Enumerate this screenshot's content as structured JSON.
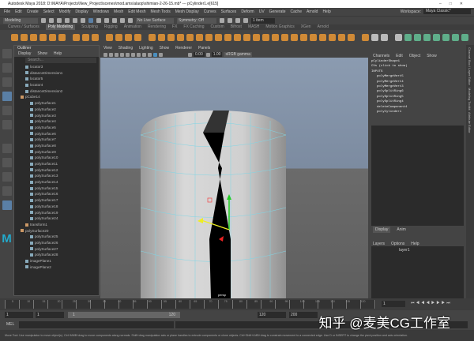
{
  "title": "Autodesk Maya 2018: D:\\MAYA\\Projects\\New_Project\\scenes\\mod.ams\\alaop\\shimian-2-26-15.mb* --- pCylinder1.e[615]",
  "menu": [
    "File",
    "Edit",
    "Create",
    "Select",
    "Modify",
    "Display",
    "Windows",
    "Mesh",
    "Edit Mesh",
    "Mesh Tools",
    "Mesh Display",
    "Curves",
    "Surfaces",
    "Deform",
    "UV",
    "Generate",
    "Cache",
    "Arnold",
    "Help"
  ],
  "workspace": {
    "label": "Workspace:",
    "value": "Maya Classic*"
  },
  "status": {
    "mode": "Modeling",
    "live": "No Live Surface",
    "symmetry": "Symmetry: Off",
    "field": "1 item"
  },
  "shelf_tabs": [
    "Curves / Surfaces",
    "Poly Modeling",
    "Sculpting",
    "Rigging",
    "Animation",
    "Rendering",
    "FX",
    "FX Caching",
    "Custom",
    "Bifrost",
    "MASH",
    "Motion Graphics",
    "XGen",
    "Arnold"
  ],
  "shelf_active": 1,
  "outliner": {
    "title": "Outliner",
    "menu": [
      "Display",
      "Show",
      "Help"
    ],
    "search": "Search...",
    "items": [
      {
        "n": "locator3",
        "d": 1
      },
      {
        "n": "distanceDimension1",
        "d": 1
      },
      {
        "n": "locator5",
        "d": 1
      },
      {
        "n": "locator4",
        "d": 1
      },
      {
        "n": "distanceDimension2",
        "d": 1
      },
      {
        "n": "pCube14",
        "d": 0,
        "t": 1
      },
      {
        "n": "polySurface1",
        "d": 2
      },
      {
        "n": "polySurface2",
        "d": 2
      },
      {
        "n": "polySurface3",
        "d": 2
      },
      {
        "n": "polySurface4",
        "d": 2
      },
      {
        "n": "polySurface5",
        "d": 2
      },
      {
        "n": "polySurface6",
        "d": 2
      },
      {
        "n": "polySurface7",
        "d": 2
      },
      {
        "n": "polySurface8",
        "d": 2
      },
      {
        "n": "polySurface9",
        "d": 2
      },
      {
        "n": "polySurface10",
        "d": 2
      },
      {
        "n": "polySurface11",
        "d": 2
      },
      {
        "n": "polySurface12",
        "d": 2
      },
      {
        "n": "polySurface13",
        "d": 2
      },
      {
        "n": "polySurface14",
        "d": 2
      },
      {
        "n": "polySurface15",
        "d": 2
      },
      {
        "n": "polySurface16",
        "d": 2
      },
      {
        "n": "polySurface17",
        "d": 2
      },
      {
        "n": "polySurface18",
        "d": 2
      },
      {
        "n": "polySurface19",
        "d": 2
      },
      {
        "n": "polySurface24",
        "d": 2
      },
      {
        "n": "transform1",
        "d": 1,
        "t": 1
      },
      {
        "n": "polySurface20",
        "d": 0,
        "t": 1
      },
      {
        "n": "polySurface25",
        "d": 2
      },
      {
        "n": "polySurface26",
        "d": 2
      },
      {
        "n": "polySurface27",
        "d": 2
      },
      {
        "n": "polySurface28",
        "d": 2
      },
      {
        "n": "imagePlane1",
        "d": 1
      },
      {
        "n": "imagePlane2",
        "d": 1
      }
    ]
  },
  "viewport": {
    "menu": [
      "View",
      "Shading",
      "Lighting",
      "Show",
      "Renderer",
      "Panels"
    ],
    "val1": "0.00",
    "val2": "1.00",
    "cam": "sRGB gamma",
    "label": "persp"
  },
  "channel_box": {
    "menu": [
      "Channels",
      "Edit",
      "Object",
      "Show"
    ],
    "shape": "pCylinderShape1",
    "hint": "CVs (click to show)",
    "inputs": "INPUTS",
    "nodes": [
      "polyMergeVert5",
      "polyMergeVert4",
      "polyMergeVert3",
      "polySplitRing6",
      "polySplitRing5",
      "polySplitRing4",
      "deleteComponent4",
      "polyCylinder1"
    ]
  },
  "layers": {
    "tabs": [
      "Display",
      "Anim"
    ],
    "menu": [
      "Layers",
      "Options",
      "Help"
    ],
    "layer": "layer1"
  },
  "side_tabs": [
    "Channel Box / Layer Editor",
    "Modeling Toolkit",
    "Attribute Editor"
  ],
  "timeline": {
    "ticks": [
      "5",
      "10",
      "15",
      "20",
      "25",
      "30",
      "35",
      "40",
      "45",
      "50",
      "55",
      "60",
      "65",
      "70",
      "75",
      "80",
      "85",
      "90",
      "95",
      "100",
      "105",
      "110",
      "115",
      "120"
    ],
    "current": "1"
  },
  "range": {
    "start": "1",
    "start2": "1",
    "inner_start": "1",
    "inner_end": "120",
    "end": "120",
    "end2": "200"
  },
  "mel": {
    "label": "MEL"
  },
  "help": "Move Tool: Use manipulator to move object(s). Ctrl+MMB+drag to move components along normals. Shift+drag manipulator axis or plane handles to extrude components or clone objects. Ctrl+Shift+LMB+drag to constrain movement to a connected edge. Use D or INSERT to change the pivot position and axis orientation.",
  "watermark": "知乎 @麦美CG工作室"
}
